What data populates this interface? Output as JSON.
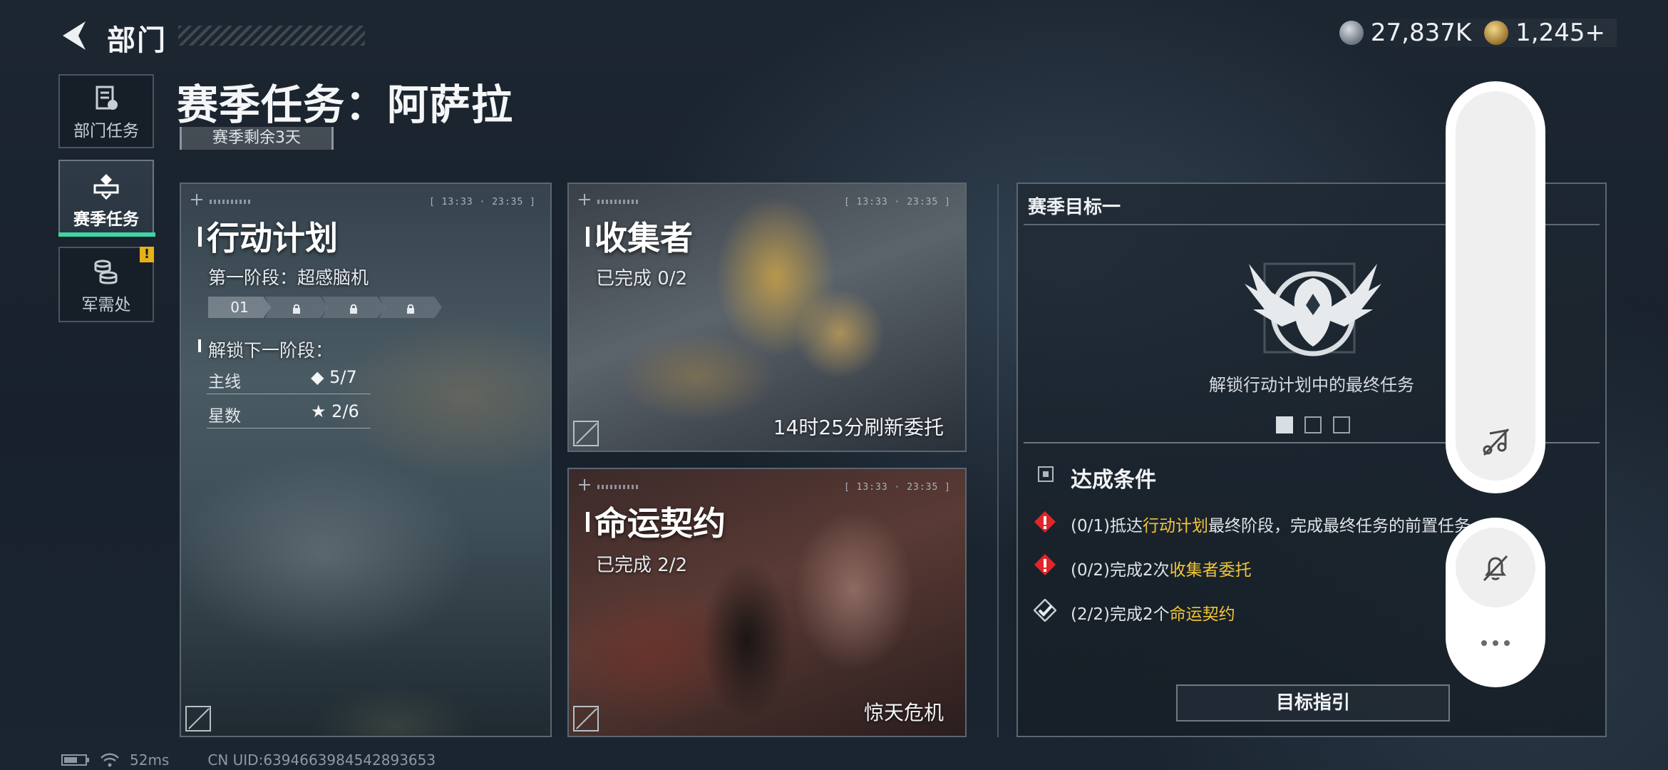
{
  "header": {
    "back_label": "部门",
    "currency": [
      {
        "icon": "silver-coin-icon",
        "value": "27,837K"
      },
      {
        "icon": "gold-coin-icon",
        "value": "1,245+"
      }
    ]
  },
  "nav": {
    "items": [
      {
        "icon": "document-icon",
        "label": "部门任务"
      },
      {
        "icon": "season-emblem-icon",
        "label": "赛季任务",
        "active": true
      },
      {
        "icon": "coin-stack-icon",
        "label": "军需处",
        "badge": "!"
      }
    ]
  },
  "page": {
    "title": "赛季任务：阿萨拉",
    "season_remaining": "赛季剩余3天"
  },
  "cards": {
    "plan": {
      "time": "[ 13:33 · 23:35 ]",
      "title": "行动计划",
      "phase": "第一阶段：超感脑机",
      "stages": [
        "01",
        "lock",
        "lock",
        "lock"
      ],
      "unlock_label": "解锁下一阶段：",
      "main_label": "主线",
      "main_value": "◆ 5/7",
      "stars_label": "星数",
      "stars_value": "★ 2/6"
    },
    "collector": {
      "time": "[ 13:33 · 23:35 ]",
      "title": "收集者",
      "status": "已完成 0/2",
      "note": "14时25分刷新委托"
    },
    "fate": {
      "time": "[ 13:33 · 23:35 ]",
      "title": "命运契约",
      "status": "已完成 2/2",
      "note": "惊天危机"
    }
  },
  "goal": {
    "heading": "赛季目标一",
    "emblem": "eagle-emblem-icon",
    "unlock_text": "解锁行动计划中的最终任务",
    "conditions_title": "达成条件",
    "conditions": [
      {
        "icon": "warning-icon",
        "prefix": "(0/1)抵达",
        "highlight": "行动计划",
        "suffix": "最终阶段，完成最终任务的前置任务"
      },
      {
        "icon": "warning-icon",
        "prefix": "(0/2)完成2次",
        "highlight": "收集者委托",
        "suffix": ""
      },
      {
        "icon": "check-icon",
        "prefix": "(2/2)完成2个",
        "highlight": "命运契约",
        "suffix": ""
      }
    ],
    "guide_button": "目标指引"
  },
  "footer": {
    "ping": "52ms",
    "uid": "CN UID:6394663984542893653"
  },
  "colors": {
    "accent_green": "#3fd6a2",
    "highlight_gold": "#f0c537",
    "warning_red": "#e0262b",
    "badge_yellow": "#e6b219"
  }
}
